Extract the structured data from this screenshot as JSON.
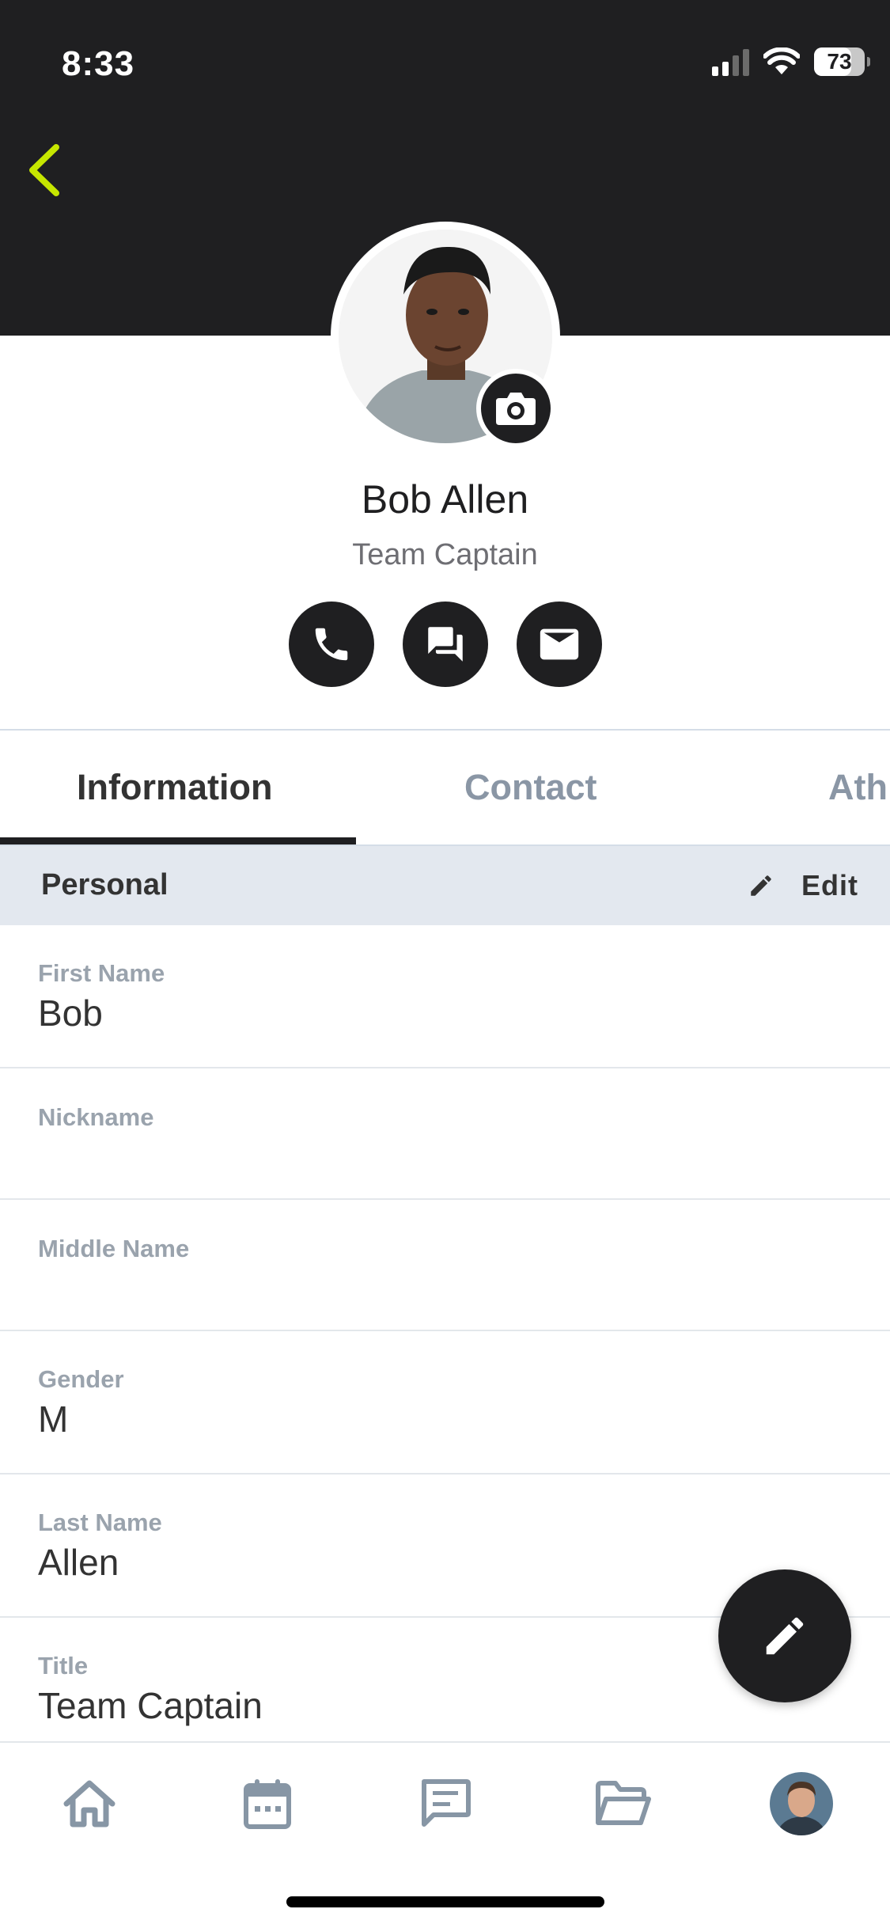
{
  "status_bar": {
    "time": "8:33",
    "battery": "73",
    "battery_level": 0.73,
    "signal_bars_filled": 2,
    "signal_bars_total": 4
  },
  "header": {
    "back_icon": "chevron-left-icon",
    "accent_color": "#c6e600",
    "bar_color": "#1f1f21"
  },
  "profile": {
    "name": "Bob Allen",
    "title": "Team Captain",
    "camera_icon": "camera-icon",
    "actions": [
      {
        "icon": "phone-icon"
      },
      {
        "icon": "chat-icon"
      },
      {
        "icon": "mail-icon"
      }
    ]
  },
  "tabs": [
    {
      "label": "Information",
      "active": true
    },
    {
      "label": "Contact",
      "active": false
    },
    {
      "label": "Ath",
      "active": false
    }
  ],
  "section": {
    "title": "Personal",
    "edit_label": "Edit",
    "edit_icon": "pencil-icon"
  },
  "fields": [
    {
      "label": "First Name",
      "value": "Bob"
    },
    {
      "label": "Nickname",
      "value": ""
    },
    {
      "label": "Middle Name",
      "value": ""
    },
    {
      "label": "Gender",
      "value": "M"
    },
    {
      "label": "Last Name",
      "value": "Allen"
    },
    {
      "label": "Title",
      "value": "Team Captain"
    }
  ],
  "fab_icon": "pencil-icon",
  "bottom_nav": [
    {
      "icon": "home-icon"
    },
    {
      "icon": "calendar-icon"
    },
    {
      "icon": "message-icon"
    },
    {
      "icon": "folder-icon"
    },
    {
      "icon": "profile-avatar"
    }
  ]
}
